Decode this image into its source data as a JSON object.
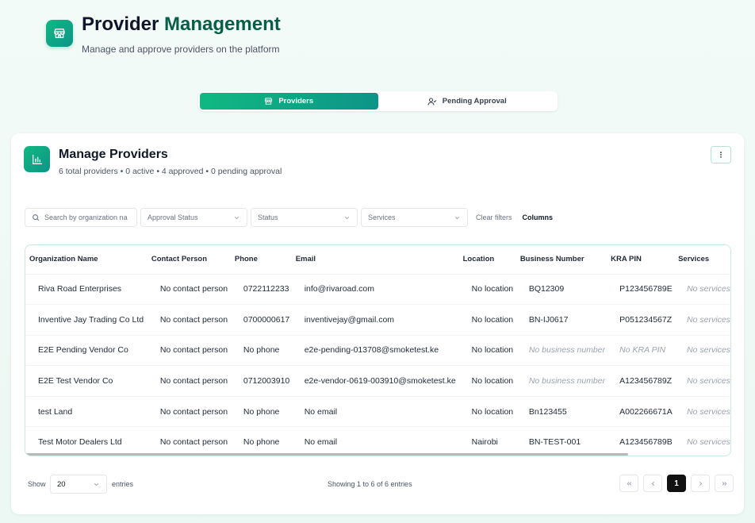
{
  "header": {
    "title_main": "Provider",
    "title_accent": "Management",
    "subtitle": "Manage and approve providers on the platform"
  },
  "tabs": [
    {
      "label": "Providers",
      "icon": "store-icon",
      "active": true
    },
    {
      "label": "Pending Approval",
      "icon": "user-check-icon",
      "active": false
    }
  ],
  "card": {
    "title": "Manage Providers",
    "summary": "6 total providers • 0 active • 4 approved • 0 pending approval"
  },
  "filters": {
    "search_placeholder": "Search by organization na",
    "approval_status": "Approval Status",
    "status": "Status",
    "services": "Services",
    "clear_label": "Clear filters",
    "columns_label": "Columns"
  },
  "table": {
    "columns": [
      "Organization Name",
      "Contact Person",
      "Phone",
      "Email",
      "Location",
      "Business Number",
      "KRA PIN",
      "Services"
    ],
    "rows": [
      [
        "Riva Road Enterprises",
        "No contact person",
        "0722112233",
        "info@rivaroad.com",
        "No location",
        "BQ12309",
        "P123456789E",
        "No services"
      ],
      [
        "Inventive Jay Trading Co Ltd",
        "No contact person",
        "0700000617",
        "inventivejay@gmail.com",
        "No location",
        "BN-IJ0617",
        "P051234567Z",
        "No services"
      ],
      [
        "E2E Pending Vendor Co",
        "No contact person",
        "No phone",
        "e2e-pending-013708@smoketest.ke",
        "No location",
        "No business number",
        "No KRA PIN",
        "No services"
      ],
      [
        "E2E Test Vendor Co",
        "No contact person",
        "0712003910",
        "e2e-vendor-0619-003910@smoketest.ke",
        "No location",
        "No business number",
        "A123456789Z",
        "No services"
      ],
      [
        "test Land",
        "No contact person",
        "No phone",
        "No email",
        "No location",
        "Bn123455",
        "A002266671A",
        "No services"
      ],
      [
        "Test Motor Dealers Ltd",
        "No contact person",
        "No phone",
        "No email",
        "Nairobi",
        "BN-TEST-001",
        "A123456789B",
        "No services"
      ]
    ]
  },
  "footer": {
    "show_label": "Show",
    "page_size": "20",
    "entries_label": "entries",
    "showing_text": "Showing 1 to 6 of 6 entries",
    "current_page": "1"
  }
}
